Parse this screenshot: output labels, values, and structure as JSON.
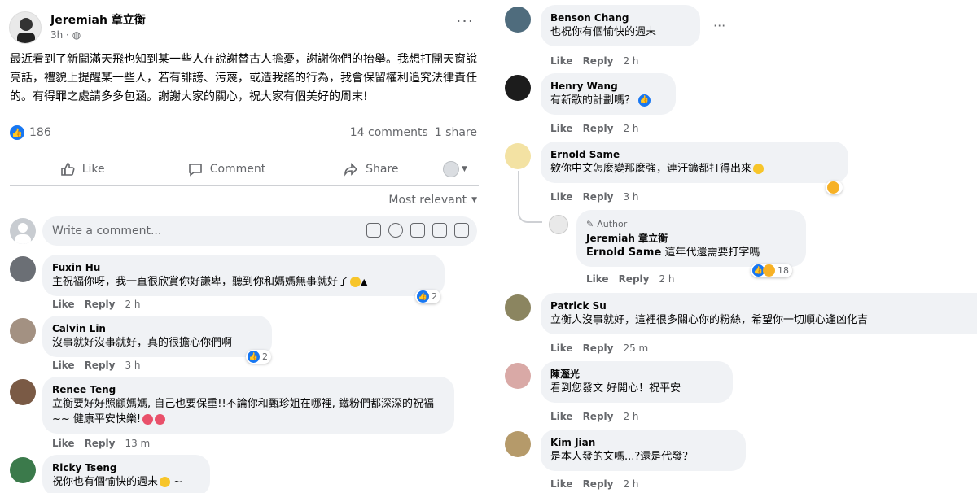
{
  "post": {
    "author": "Jeremiah 章立衡",
    "time": "3h ·",
    "body": "最近看到了新聞滿天飛也知到某一些人在說謝替古人擔憂，謝謝你們的抬舉。我想打開天窗說亮話，禮貌上提醒某一些人，若有誹謗、污蔑，或造我謠的行為，我會保留權利追究法律責任的。有得罪之處請多多包涵。謝謝大家的關心，祝大家有個美好的周末!",
    "reactions": "186",
    "comments_count": "14 comments",
    "shares_count": "1 share"
  },
  "actions": {
    "like": "Like",
    "comment": "Comment",
    "share": "Share"
  },
  "sort_label": "Most relevant",
  "write_placeholder": "Write a comment...",
  "left_comments": [
    {
      "name": "Fuxin Hu",
      "text": "主祝福你呀，我一直很欣賞你好謙卑，聽到你和媽媽無事就好了",
      "time": "2 h",
      "reactions": "2"
    },
    {
      "name": "Calvin Lin",
      "text": "沒事就好沒事就好，真的很擔心你們啊",
      "time": "3 h",
      "reactions": "2"
    },
    {
      "name": "Renee Teng",
      "text": "立衡要好好照顧媽媽, 自己也要保重!!不論你和甄珍姐在哪裡, 鐵粉們都深深的祝福~~ 健康平安快樂!",
      "time": "13 m",
      "reactions": ""
    },
    {
      "name": "Ricky Tseng",
      "text": "祝你也有個愉快的週末",
      "time": "",
      "reactions": ""
    }
  ],
  "right_comments": [
    {
      "name": "Benson Chang",
      "text": "也祝你有個愉快的週末",
      "time": "2 h"
    },
    {
      "name": "Henry Wang",
      "text": "有新歌的計劃嗎？",
      "time": "2 h"
    },
    {
      "name": "Ernold Same",
      "text": "欸你中文怎麼變那麼強，連汙鑛都打得出來",
      "time": "3 h"
    },
    {
      "name": "Patrick Su",
      "text": "立衡人沒事就好，這裡很多關心你的粉絲，希望你一切順心逢凶化吉",
      "time": "25 m"
    },
    {
      "name": "陳溼光",
      "text": "看到您發文 好開心！祝平安",
      "time": "2 h"
    },
    {
      "name": "Kim Jian",
      "text": "是本人發的文嗎...?還是代發？",
      "time": "2 h"
    }
  ],
  "reply": {
    "tag": "Author",
    "name": "Jeremiah 章立衡",
    "mention": "Ernold Same",
    "text": " 這年代還需要打字嗎",
    "time": "2 h",
    "reactions": "18"
  },
  "labels": {
    "like": "Like",
    "reply": "Reply"
  },
  "colors": {
    "accent": "#1877f2",
    "bubble": "#f0f2f5",
    "meta": "#65676b"
  }
}
